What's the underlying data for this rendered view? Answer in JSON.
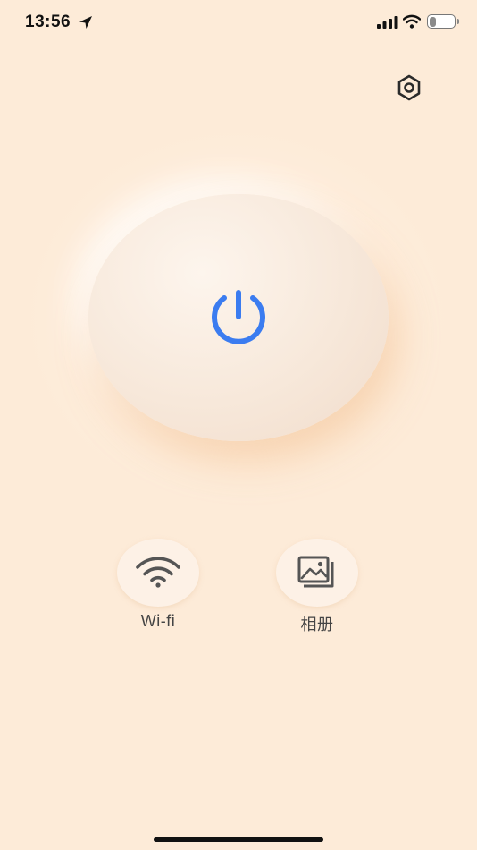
{
  "status_bar": {
    "time": "13:56",
    "battery_level": "26",
    "battery_fraction": 0.26,
    "location_icon": "location-arrow-icon",
    "signal_icon": "cellular-signal-icon",
    "wifi_icon": "wifi-icon",
    "battery_icon": "battery-icon"
  },
  "header": {
    "settings_icon": "gear-icon"
  },
  "power": {
    "icon": "power-icon",
    "icon_color": "#3b7cf0"
  },
  "actions": [
    {
      "label": "Wi-fi",
      "icon": "wifi-icon"
    },
    {
      "label": "相册",
      "icon": "photo-album-icon"
    }
  ],
  "colors": {
    "background": "#fdebd8",
    "accent": "#3b7cf0",
    "icon_gray": "#555555"
  }
}
